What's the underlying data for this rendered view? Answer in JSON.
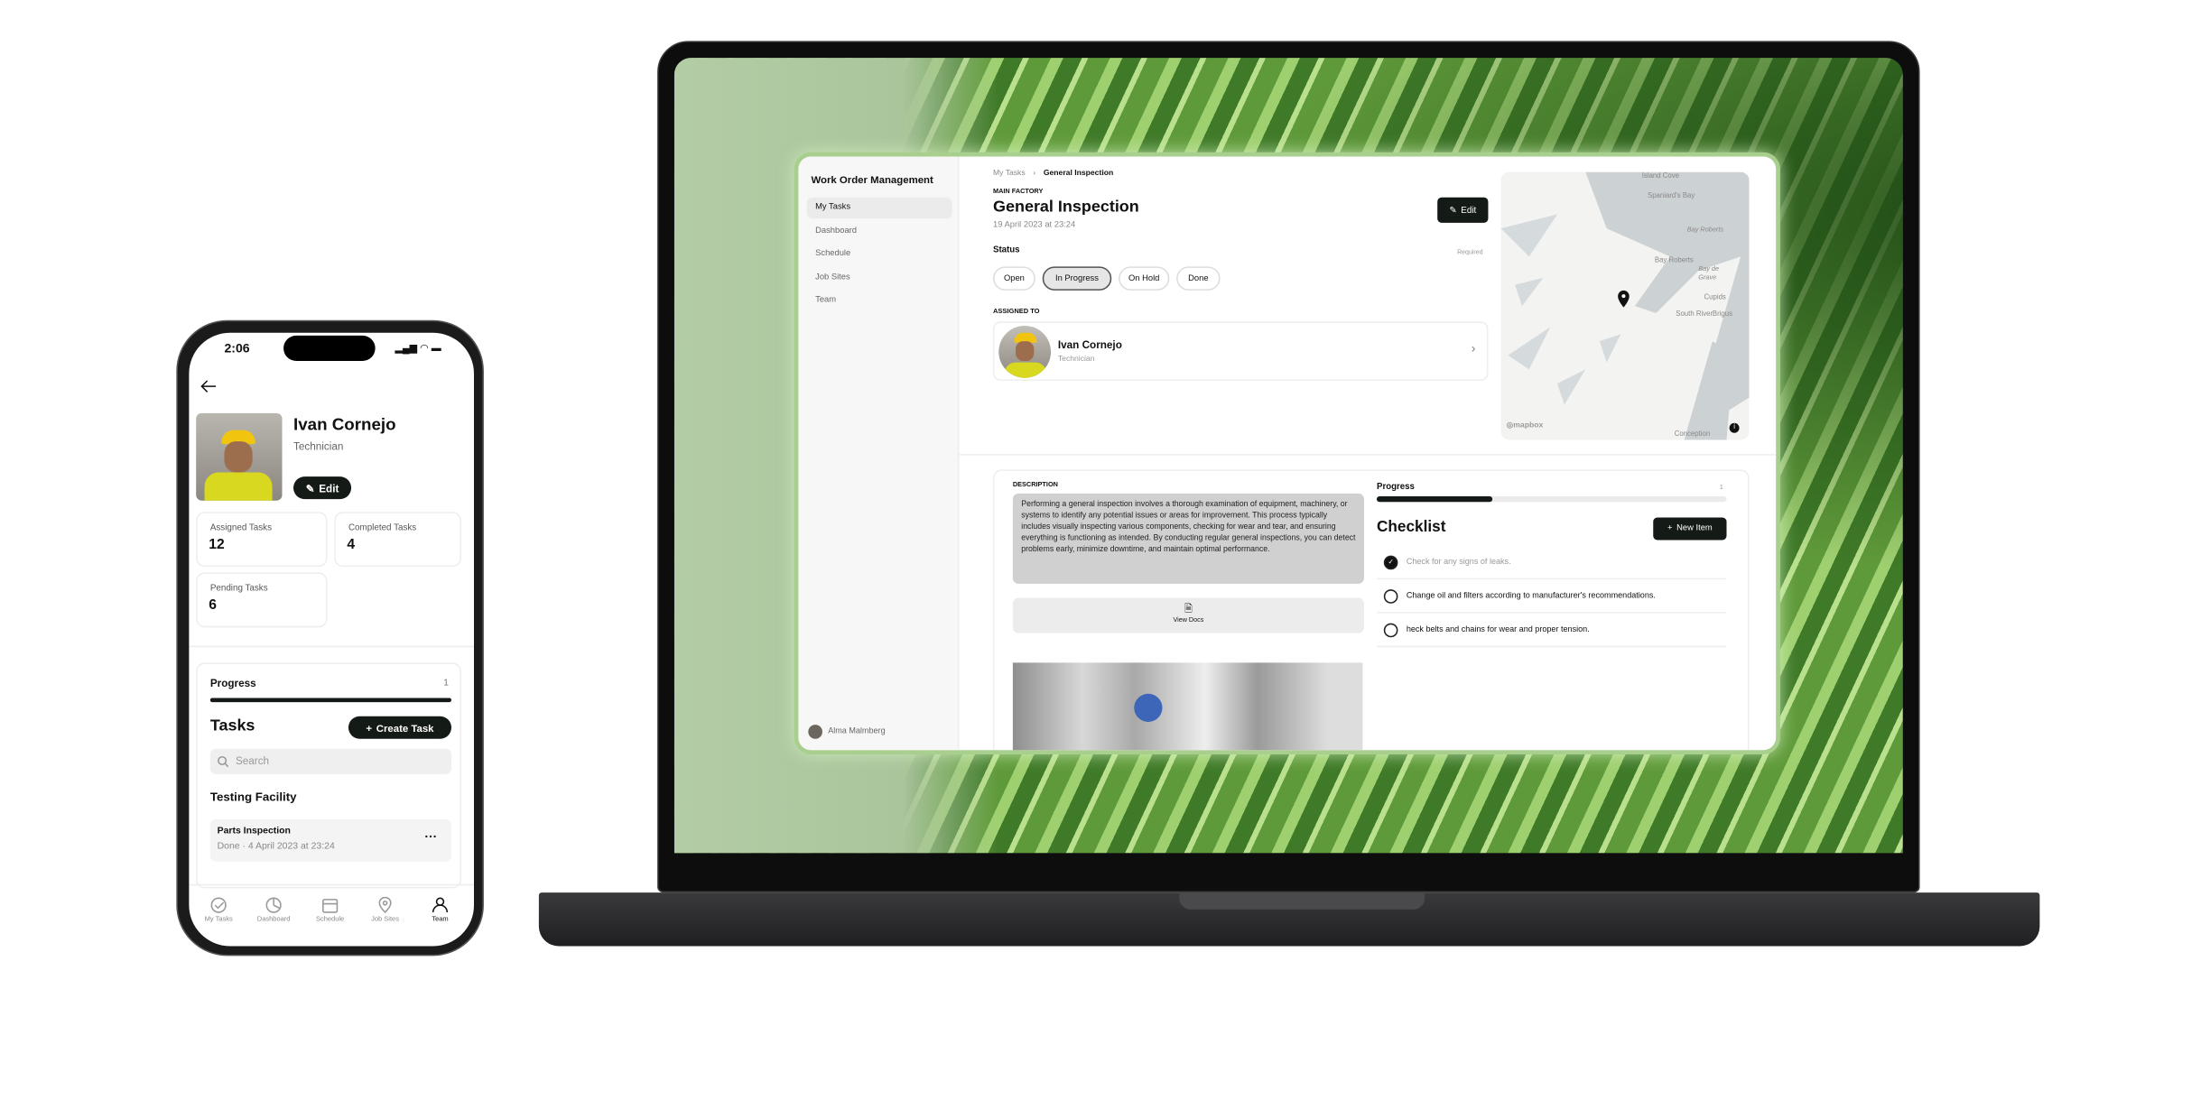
{
  "phone": {
    "status_time": "2:06",
    "profile": {
      "name": "Ivan Cornejo",
      "role": "Technician",
      "edit_label": "Edit"
    },
    "stats": [
      {
        "label": "Assigned Tasks",
        "value": "12"
      },
      {
        "label": "Completed Tasks",
        "value": "4"
      },
      {
        "label": "Pending Tasks",
        "value": "6"
      }
    ],
    "progress": {
      "label": "Progress",
      "count": "1",
      "fraction": 1.0
    },
    "tasks": {
      "title": "Tasks",
      "create_label": "Create Task",
      "search_placeholder": "Search",
      "group": "Testing Facility",
      "items": [
        {
          "title": "Parts Inspection",
          "meta": "Done · 4 April 2023 at 23:24"
        }
      ]
    },
    "tabbar": [
      {
        "label": "My Tasks",
        "icon": "check-circle-icon"
      },
      {
        "label": "Dashboard",
        "icon": "pie-chart-icon"
      },
      {
        "label": "Schedule",
        "icon": "calendar-icon"
      },
      {
        "label": "Job Sites",
        "icon": "map-pin-icon"
      },
      {
        "label": "Team",
        "icon": "person-icon",
        "active": true
      }
    ]
  },
  "app": {
    "title": "Work Order Management",
    "nav": [
      {
        "label": "My Tasks",
        "active": true
      },
      {
        "label": "Dashboard"
      },
      {
        "label": "Schedule"
      },
      {
        "label": "Job Sites"
      },
      {
        "label": "Team"
      }
    ],
    "user": "Alma Malmberg",
    "breadcrumb": [
      "My Tasks",
      "General Inspection"
    ],
    "location": "MAIN FACTORY",
    "task_title": "General Inspection",
    "date": "19 April 2023 at 23:24",
    "edit_label": "Edit",
    "status": {
      "label": "Status",
      "required": "Required",
      "options": [
        "Open",
        "In Progress",
        "On Hold",
        "Done"
      ],
      "selected": "In Progress"
    },
    "assigned": {
      "label": "ASSIGNED TO",
      "name": "Ivan Cornejo",
      "role": "Technician"
    },
    "map": {
      "labels": [
        "Island Cove",
        "Spaniard's Bay",
        "Bay Roberts",
        "Bay Roberts",
        "Bay de Grave",
        "Cupids",
        "South River",
        "Brigus",
        "Conception"
      ],
      "attribution": "mapbox"
    },
    "description": {
      "label": "DESCRIPTION",
      "text": "Performing a general inspection involves a thorough examination of equipment, machinery, or systems to identify any potential issues or areas for improvement. This process typically includes visually inspecting various components, checking for wear and tear, and ensuring everything is functioning as intended. By conducting regular general inspections, you can detect problems early, minimize downtime, and maintain optimal performance.",
      "docs_label": "View Docs"
    },
    "progress": {
      "label": "Progress",
      "count": "1",
      "fraction": 0.33
    },
    "checklist": {
      "title": "Checklist",
      "new_label": "New Item",
      "items": [
        {
          "text": "Check for any signs of leaks.",
          "done": true
        },
        {
          "text": "Change oil and filters according to manufacturer's recommendations.",
          "done": false
        },
        {
          "text": "heck belts and chains for wear and proper tension.",
          "done": false
        }
      ]
    }
  },
  "colors": {
    "dark": "#141a16",
    "wallpaper_green": "#7aad55",
    "frame_green": "#a9cf8e"
  }
}
